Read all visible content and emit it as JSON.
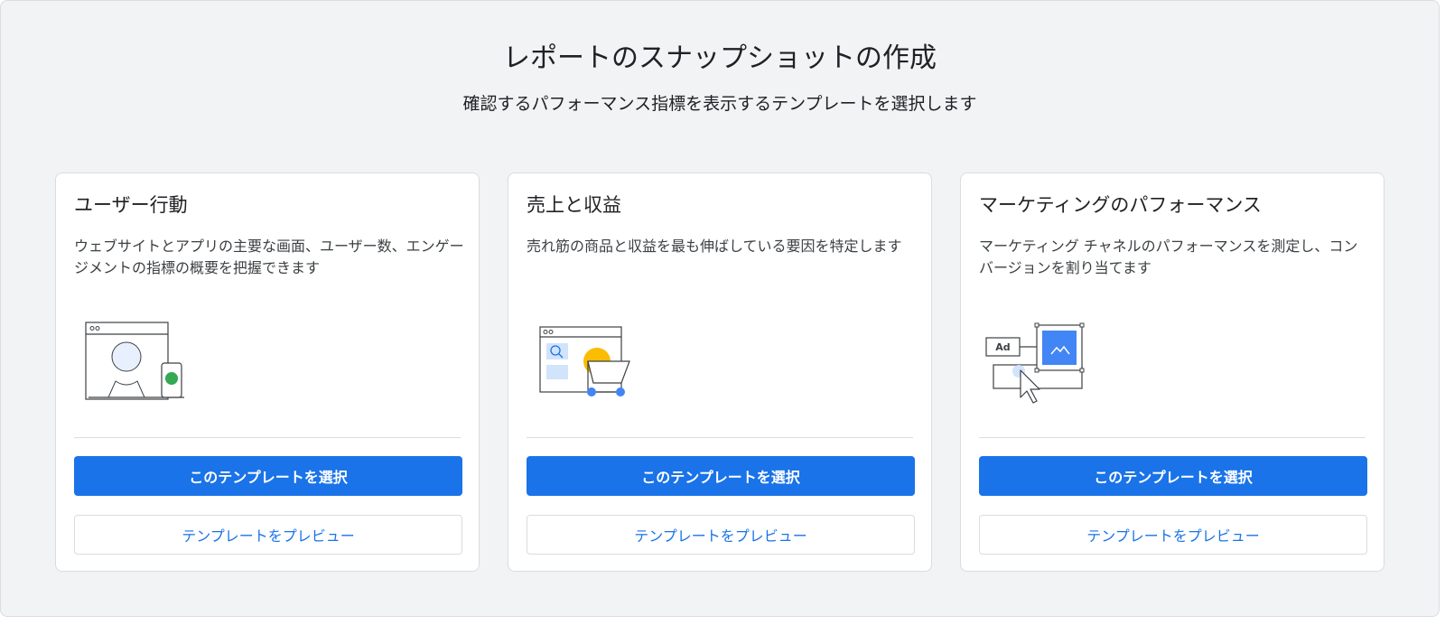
{
  "header": {
    "title": "レポートのスナップショットの作成",
    "subtitle": "確認するパフォーマンス指標を表示するテンプレートを選択します"
  },
  "cards": [
    {
      "title": "ユーザー行動",
      "description": "ウェブサイトとアプリの主要な画面、ユーザー数、エンゲージメントの指標の概要を把握できます",
      "illustration": "user-behavior-illustration",
      "select_label": "このテンプレートを選択",
      "preview_label": "テンプレートをプレビュー"
    },
    {
      "title": "売上と収益",
      "description": "売れ筋の商品と収益を最も伸ばしている要因を特定します",
      "illustration": "sales-revenue-illustration",
      "select_label": "このテンプレートを選択",
      "preview_label": "テンプレートをプレビュー"
    },
    {
      "title": "マーケティングのパフォーマンス",
      "description": "マーケティング チャネルのパフォーマンスを測定し、コンバージョンを割り当てます",
      "illustration": "marketing-performance-illustration",
      "ad_label": "Ad",
      "select_label": "このテンプレートを選択",
      "preview_label": "テンプレートをプレビュー"
    }
  ],
  "colors": {
    "primary": "#1a73e8",
    "panel_background": "#f1f3f4",
    "card_background": "#ffffff",
    "border": "#dadce0",
    "accent_green": "#34a853",
    "accent_yellow": "#fbbc04",
    "light_blue": "#d2e3fc"
  }
}
